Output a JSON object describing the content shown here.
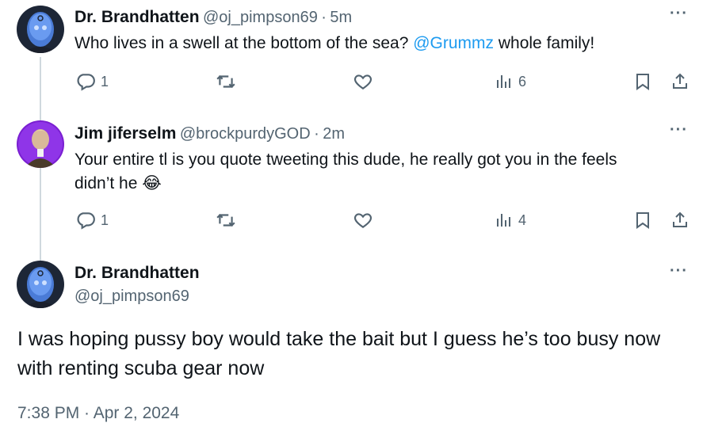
{
  "tweets": [
    {
      "display_name": "Dr. Brandhatten",
      "handle": "@oj_pimpson69",
      "separator": "·",
      "time": "5m",
      "text_before": "Who lives in a swell at the bottom of the sea? ",
      "mention": "@Grummz",
      "text_after": " whole family!",
      "reply_count": "1",
      "views": "6"
    },
    {
      "display_name": "Jim jiferselm",
      "handle": "@brockpurdyGOD",
      "separator": "·",
      "time": "2m",
      "text_line1": "Your entire tl is you quote tweeting this dude, he really got you in the feels",
      "text_line2": "didn’t he",
      "emoji": "😂",
      "reply_count": "1",
      "views": "4"
    }
  ],
  "main_tweet": {
    "display_name": "Dr. Brandhatten",
    "handle": "@oj_pimpson69",
    "text_line1": "I was hoping pussy boy would take the bait but I guess he’s too busy now",
    "text_line2": "with renting scuba gear now",
    "timestamp": "7:38 PM · Apr 2, 2024"
  },
  "more_glyph": "···",
  "colors": {
    "accent": "#1d9bf0",
    "secondary_text": "#536471",
    "primary_text": "#0f1419",
    "thread_line": "#cfd9de"
  },
  "icons": [
    "reply-icon",
    "retweet-icon",
    "like-icon",
    "views-icon",
    "bookmark-icon",
    "share-icon",
    "more-icon"
  ]
}
